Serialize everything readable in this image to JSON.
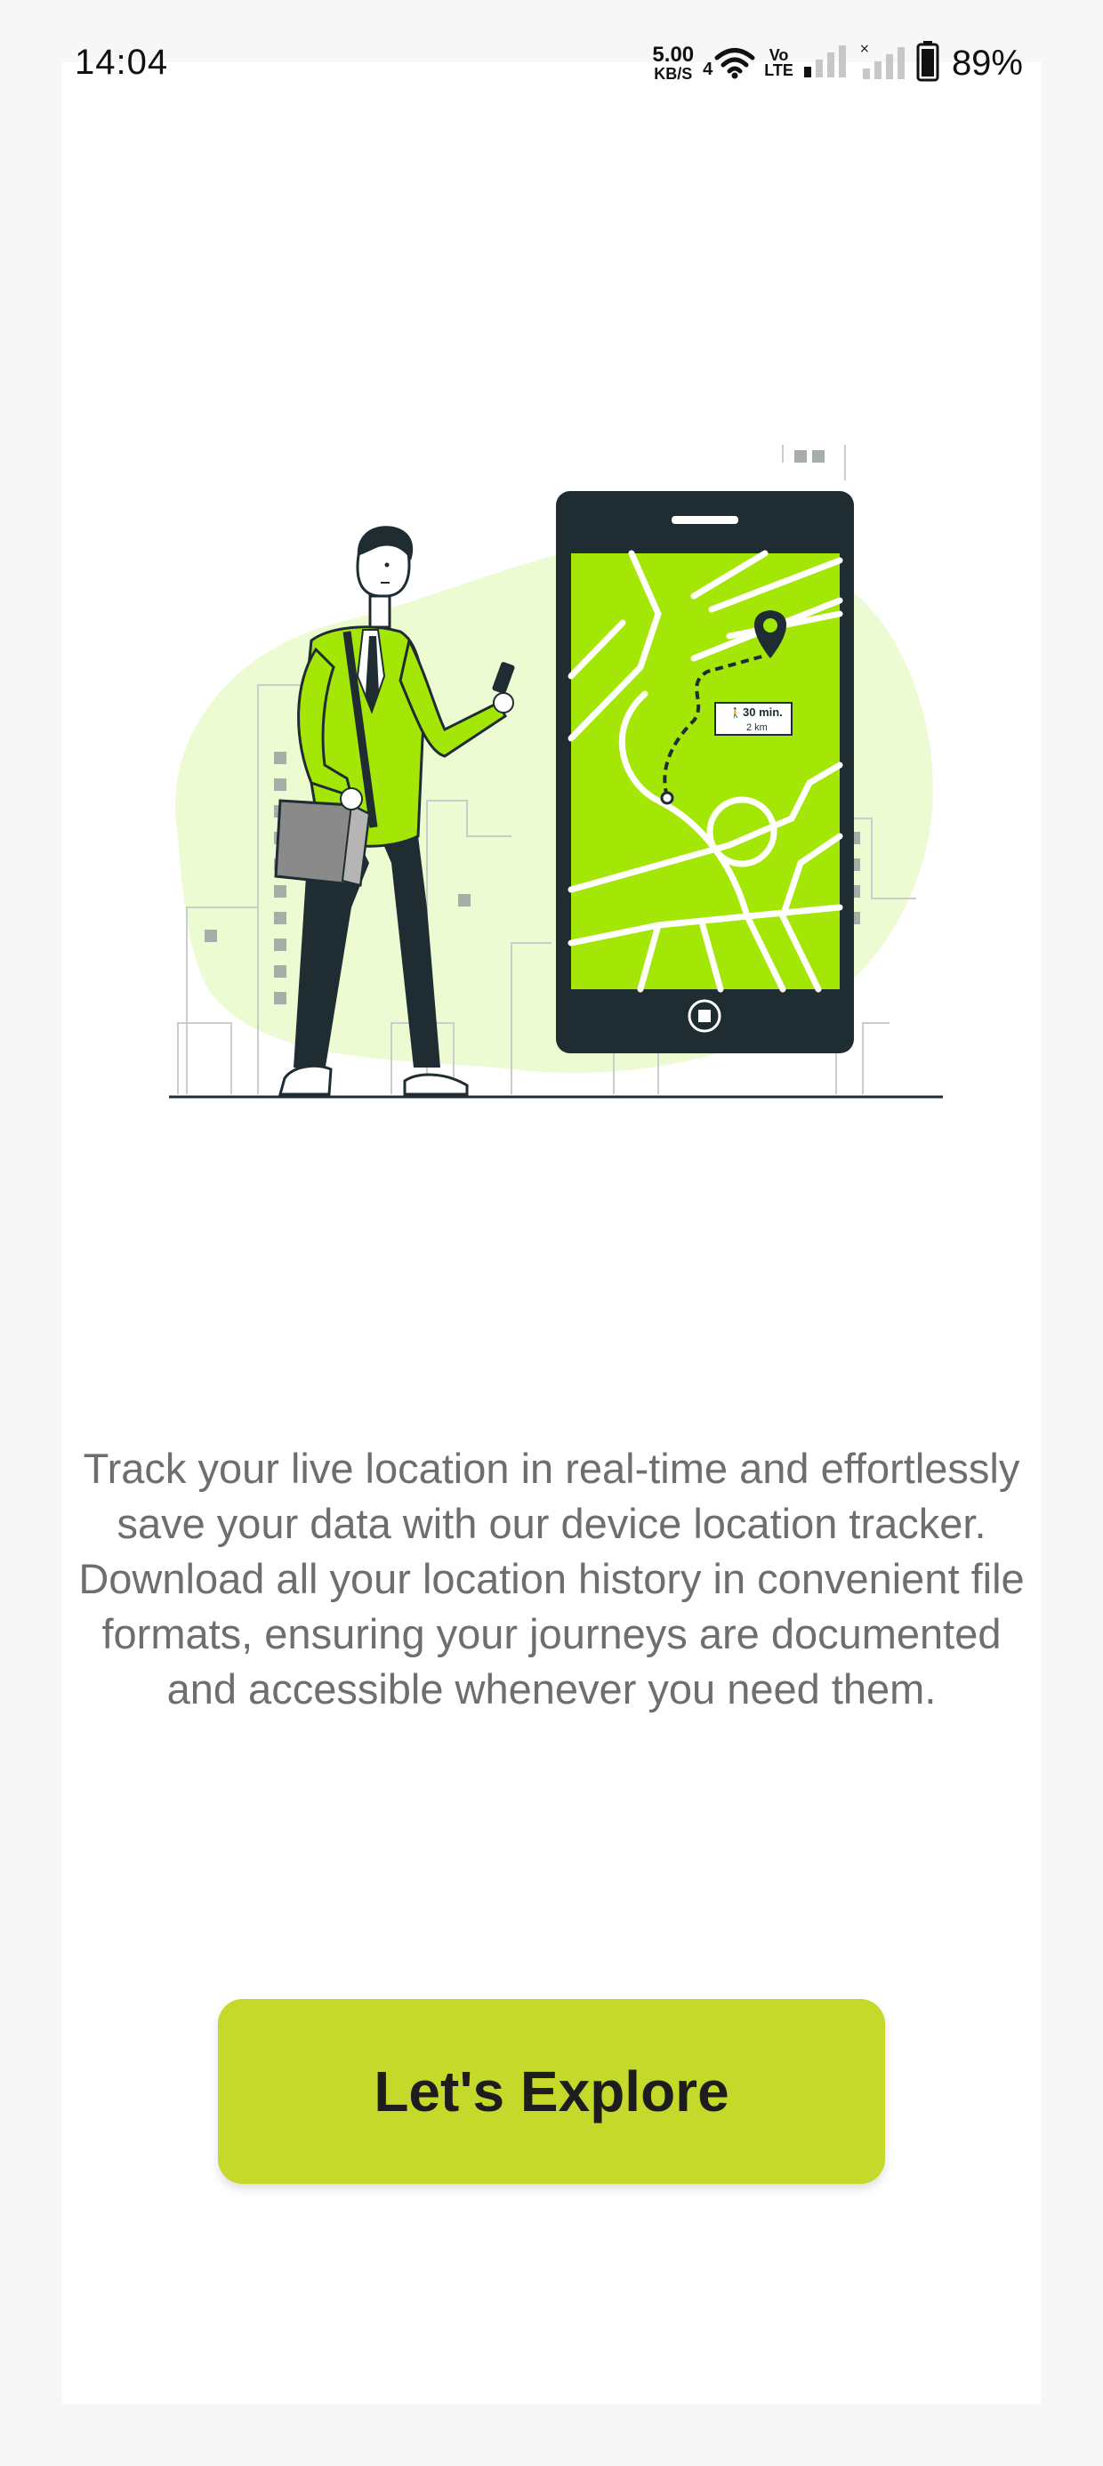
{
  "status_bar": {
    "time": "14:04",
    "net_speed_value": "5.00",
    "net_speed_unit": "KB/S",
    "network_type": "4",
    "volte_line1": "Vo",
    "volte_line2": "LTE",
    "battery_percent": "89%",
    "icons": [
      "wifi-icon",
      "signal-bars-icon",
      "no-signal-icon",
      "battery-icon"
    ]
  },
  "illustration": {
    "icon": "person-with-map-phone-illustration",
    "route_label_time": "30 min.",
    "route_label_distance": "2 km",
    "colors": {
      "accent_green": "#a4e605",
      "blob": "#ecfbd2",
      "dark": "#1f2d33"
    }
  },
  "onboarding": {
    "description": "Track your live location in real-time and effortlessly save your data with our device location tracker. Download all your location history in convenient file formats, ensuring your journeys are documented and accessible whenever you need them.",
    "button_label": "Let's Explore",
    "button_color": "#c5d92b"
  }
}
